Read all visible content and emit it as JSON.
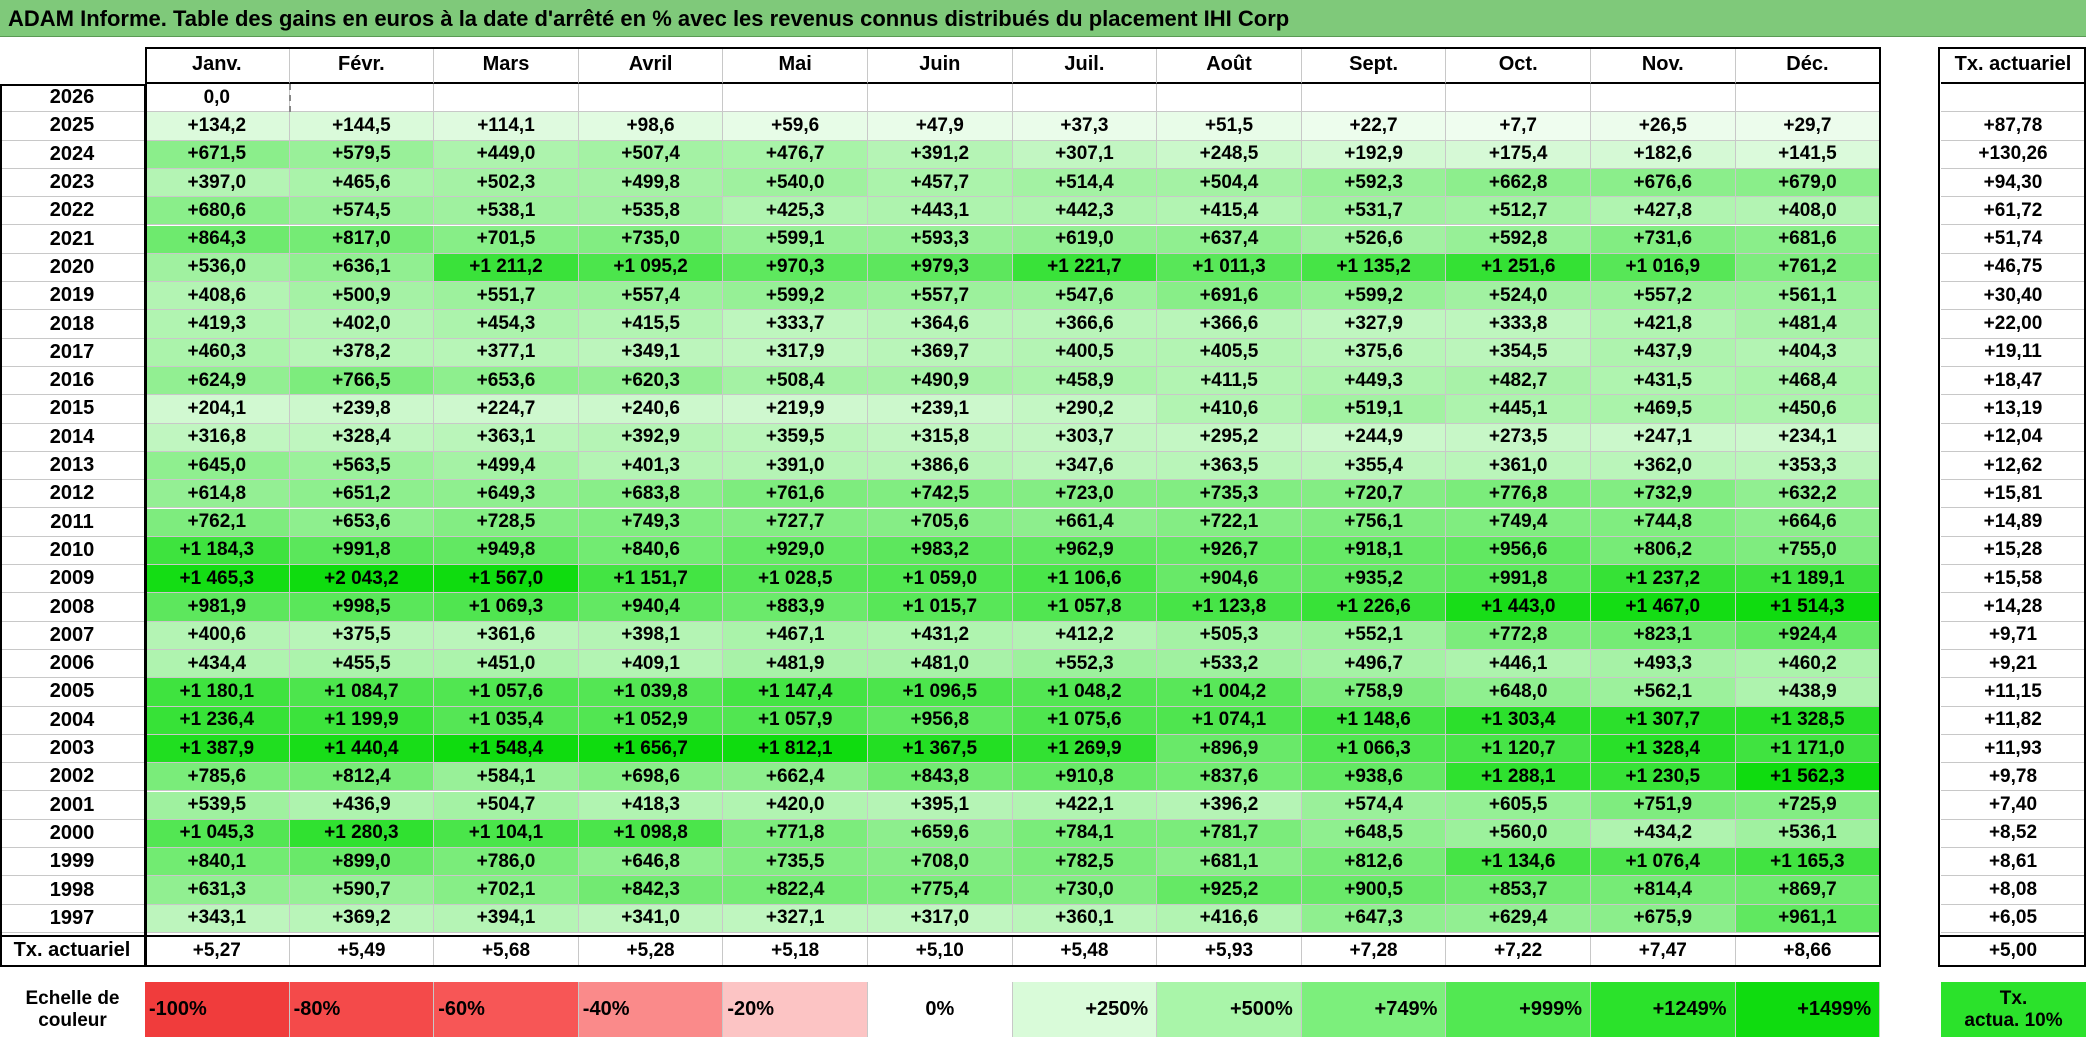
{
  "title": "ADAM Informe. Table des gains en euros à la date d'arrêté en % avec les revenus connus distribués du placement IHI Corp",
  "months": [
    "Janv.",
    "Févr.",
    "Mars",
    "Avril",
    "Mai",
    "Juin",
    "Juil.",
    "Août",
    "Sept.",
    "Oct.",
    "Nov.",
    "Déc."
  ],
  "rate_header": "Tx. actuariel",
  "rows": [
    {
      "year": "2026",
      "values": [
        "0,0",
        "",
        "",
        "",
        "",
        "",
        "",
        "",
        "",
        "",
        "",
        ""
      ],
      "rate": ""
    },
    {
      "year": "2025",
      "values": [
        "+134,2",
        "+144,5",
        "+114,1",
        "+98,6",
        "+59,6",
        "+47,9",
        "+37,3",
        "+51,5",
        "+22,7",
        "+7,7",
        "+26,5",
        "+29,7"
      ],
      "rate": "+87,78"
    },
    {
      "year": "2024",
      "values": [
        "+671,5",
        "+579,5",
        "+449,0",
        "+507,4",
        "+476,7",
        "+391,2",
        "+307,1",
        "+248,5",
        "+192,9",
        "+175,4",
        "+182,6",
        "+141,5"
      ],
      "rate": "+130,26"
    },
    {
      "year": "2023",
      "values": [
        "+397,0",
        "+465,6",
        "+502,3",
        "+499,8",
        "+540,0",
        "+457,7",
        "+514,4",
        "+504,4",
        "+592,3",
        "+662,8",
        "+676,6",
        "+679,0"
      ],
      "rate": "+94,30"
    },
    {
      "year": "2022",
      "values": [
        "+680,6",
        "+574,5",
        "+538,1",
        "+535,8",
        "+425,3",
        "+443,1",
        "+442,3",
        "+415,4",
        "+531,7",
        "+512,7",
        "+427,8",
        "+408,0"
      ],
      "rate": "+61,72"
    },
    {
      "year": "2021",
      "values": [
        "+864,3",
        "+817,0",
        "+701,5",
        "+735,0",
        "+599,1",
        "+593,3",
        "+619,0",
        "+637,4",
        "+526,6",
        "+592,8",
        "+731,6",
        "+681,6"
      ],
      "rate": "+51,74"
    },
    {
      "year": "2020",
      "values": [
        "+536,0",
        "+636,1",
        "+1 211,2",
        "+1 095,2",
        "+970,3",
        "+979,3",
        "+1 221,7",
        "+1 011,3",
        "+1 135,2",
        "+1 251,6",
        "+1 016,9",
        "+761,2"
      ],
      "rate": "+46,75"
    },
    {
      "year": "2019",
      "values": [
        "+408,6",
        "+500,9",
        "+551,7",
        "+557,4",
        "+599,2",
        "+557,7",
        "+547,6",
        "+691,6",
        "+599,2",
        "+524,0",
        "+557,2",
        "+561,1"
      ],
      "rate": "+30,40"
    },
    {
      "year": "2018",
      "values": [
        "+419,3",
        "+402,0",
        "+454,3",
        "+415,5",
        "+333,7",
        "+364,6",
        "+366,6",
        "+366,6",
        "+327,9",
        "+333,8",
        "+421,8",
        "+481,4"
      ],
      "rate": "+22,00"
    },
    {
      "year": "2017",
      "values": [
        "+460,3",
        "+378,2",
        "+377,1",
        "+349,1",
        "+317,9",
        "+369,7",
        "+400,5",
        "+405,5",
        "+375,6",
        "+354,5",
        "+437,9",
        "+404,3"
      ],
      "rate": "+19,11"
    },
    {
      "year": "2016",
      "values": [
        "+624,9",
        "+766,5",
        "+653,6",
        "+620,3",
        "+508,4",
        "+490,9",
        "+458,9",
        "+411,5",
        "+449,3",
        "+482,7",
        "+431,5",
        "+468,4"
      ],
      "rate": "+18,47"
    },
    {
      "year": "2015",
      "values": [
        "+204,1",
        "+239,8",
        "+224,7",
        "+240,6",
        "+219,9",
        "+239,1",
        "+290,2",
        "+410,6",
        "+519,1",
        "+445,1",
        "+469,5",
        "+450,6"
      ],
      "rate": "+13,19"
    },
    {
      "year": "2014",
      "values": [
        "+316,8",
        "+328,4",
        "+363,1",
        "+392,9",
        "+359,5",
        "+315,8",
        "+303,7",
        "+295,2",
        "+244,9",
        "+273,5",
        "+247,1",
        "+234,1"
      ],
      "rate": "+12,04"
    },
    {
      "year": "2013",
      "values": [
        "+645,0",
        "+563,5",
        "+499,4",
        "+401,3",
        "+391,0",
        "+386,6",
        "+347,6",
        "+363,5",
        "+355,4",
        "+361,0",
        "+362,0",
        "+353,3"
      ],
      "rate": "+12,62"
    },
    {
      "year": "2012",
      "values": [
        "+614,8",
        "+651,2",
        "+649,3",
        "+683,8",
        "+761,6",
        "+742,5",
        "+723,0",
        "+735,3",
        "+720,7",
        "+776,8",
        "+732,9",
        "+632,2"
      ],
      "rate": "+15,81"
    },
    {
      "year": "2011",
      "values": [
        "+762,1",
        "+653,6",
        "+728,5",
        "+749,3",
        "+727,7",
        "+705,6",
        "+661,4",
        "+722,1",
        "+756,1",
        "+749,4",
        "+744,8",
        "+664,6"
      ],
      "rate": "+14,89"
    },
    {
      "year": "2010",
      "values": [
        "+1 184,3",
        "+991,8",
        "+949,8",
        "+840,6",
        "+929,0",
        "+983,2",
        "+962,9",
        "+926,7",
        "+918,1",
        "+956,6",
        "+806,2",
        "+755,0"
      ],
      "rate": "+15,28"
    },
    {
      "year": "2009",
      "values": [
        "+1 465,3",
        "+2 043,2",
        "+1 567,0",
        "+1 151,7",
        "+1 028,5",
        "+1 059,0",
        "+1 106,6",
        "+904,6",
        "+935,2",
        "+991,8",
        "+1 237,2",
        "+1 189,1"
      ],
      "rate": "+15,58"
    },
    {
      "year": "2008",
      "values": [
        "+981,9",
        "+998,5",
        "+1 069,3",
        "+940,4",
        "+883,9",
        "+1 015,7",
        "+1 057,8",
        "+1 123,8",
        "+1 226,6",
        "+1 443,0",
        "+1 467,0",
        "+1 514,3"
      ],
      "rate": "+14,28"
    },
    {
      "year": "2007",
      "values": [
        "+400,6",
        "+375,5",
        "+361,6",
        "+398,1",
        "+467,1",
        "+431,2",
        "+412,2",
        "+505,3",
        "+552,1",
        "+772,8",
        "+823,1",
        "+924,4"
      ],
      "rate": "+9,71"
    },
    {
      "year": "2006",
      "values": [
        "+434,4",
        "+455,5",
        "+451,0",
        "+409,1",
        "+481,9",
        "+481,0",
        "+552,3",
        "+533,2",
        "+496,7",
        "+446,1",
        "+493,3",
        "+460,2"
      ],
      "rate": "+9,21"
    },
    {
      "year": "2005",
      "values": [
        "+1 180,1",
        "+1 084,7",
        "+1 057,6",
        "+1 039,8",
        "+1 147,4",
        "+1 096,5",
        "+1 048,2",
        "+1 004,2",
        "+758,9",
        "+648,0",
        "+562,1",
        "+438,9"
      ],
      "rate": "+11,15"
    },
    {
      "year": "2004",
      "values": [
        "+1 236,4",
        "+1 199,9",
        "+1 035,4",
        "+1 052,9",
        "+1 057,9",
        "+956,8",
        "+1 075,6",
        "+1 074,1",
        "+1 148,6",
        "+1 303,4",
        "+1 307,7",
        "+1 328,5"
      ],
      "rate": "+11,82"
    },
    {
      "year": "2003",
      "values": [
        "+1 387,9",
        "+1 440,4",
        "+1 548,4",
        "+1 656,7",
        "+1 812,1",
        "+1 367,5",
        "+1 269,9",
        "+896,9",
        "+1 066,3",
        "+1 120,7",
        "+1 328,4",
        "+1 171,0"
      ],
      "rate": "+11,93"
    },
    {
      "year": "2002",
      "values": [
        "+785,6",
        "+812,4",
        "+584,1",
        "+698,6",
        "+662,4",
        "+843,8",
        "+910,8",
        "+837,6",
        "+938,6",
        "+1 288,1",
        "+1 230,5",
        "+1 562,3"
      ],
      "rate": "+9,78"
    },
    {
      "year": "2001",
      "values": [
        "+539,5",
        "+436,9",
        "+504,7",
        "+418,3",
        "+420,0",
        "+395,1",
        "+422,1",
        "+396,2",
        "+574,4",
        "+605,5",
        "+751,9",
        "+725,9"
      ],
      "rate": "+7,40"
    },
    {
      "year": "2000",
      "values": [
        "+1 045,3",
        "+1 280,3",
        "+1 104,1",
        "+1 098,8",
        "+771,8",
        "+659,6",
        "+784,1",
        "+781,7",
        "+648,5",
        "+560,0",
        "+434,2",
        "+536,1"
      ],
      "rate": "+8,52"
    },
    {
      "year": "1999",
      "values": [
        "+840,1",
        "+899,0",
        "+786,0",
        "+646,8",
        "+735,5",
        "+708,0",
        "+782,5",
        "+681,1",
        "+812,6",
        "+1 134,6",
        "+1 076,4",
        "+1 165,3"
      ],
      "rate": "+8,61"
    },
    {
      "year": "1998",
      "values": [
        "+631,3",
        "+590,7",
        "+702,1",
        "+842,3",
        "+822,4",
        "+775,4",
        "+730,0",
        "+925,2",
        "+900,5",
        "+853,7",
        "+814,4",
        "+869,7"
      ],
      "rate": "+8,08"
    },
    {
      "year": "1997",
      "values": [
        "+343,1",
        "+369,2",
        "+394,1",
        "+341,0",
        "+327,1",
        "+317,0",
        "+360,1",
        "+416,6",
        "+647,3",
        "+629,4",
        "+675,9",
        "+961,1"
      ],
      "rate": "+6,05"
    }
  ],
  "footer": {
    "label": "Tx. actuariel",
    "values": [
      "+5,27",
      "+5,49",
      "+5,68",
      "+5,28",
      "+5,18",
      "+5,10",
      "+5,48",
      "+5,93",
      "+7,28",
      "+7,22",
      "+7,47",
      "+8,66"
    ],
    "rate": "+5,00"
  },
  "scale": {
    "label_line1": "Echelle de",
    "label_line2": "couleur",
    "items": [
      {
        "text": "-100%",
        "color": "#f03c3c",
        "align": "left"
      },
      {
        "text": "-80%",
        "color": "#f44a4a",
        "align": "left"
      },
      {
        "text": "-60%",
        "color": "#f75656",
        "align": "left"
      },
      {
        "text": "-40%",
        "color": "#fa8a8a",
        "align": "left"
      },
      {
        "text": "-20%",
        "color": "#fcc4c4",
        "align": "left"
      },
      {
        "text": "0%",
        "color": "#ffffff",
        "align": "mid"
      },
      {
        "text": "+250%",
        "color": "#d9fbd9",
        "align": "right"
      },
      {
        "text": "+500%",
        "color": "#a9f5a9",
        "align": "right"
      },
      {
        "text": "+749%",
        "color": "#7cef7c",
        "align": "right"
      },
      {
        "text": "+999%",
        "color": "#52e852",
        "align": "right"
      },
      {
        "text": "+1249%",
        "color": "#2be22b",
        "align": "right"
      },
      {
        "text": "+1499%",
        "color": "#0fdc0f",
        "align": "right"
      }
    ],
    "rate_line1": "Tx.",
    "rate_line2": "actua. 10%",
    "rate_color": "#2be22b"
  }
}
